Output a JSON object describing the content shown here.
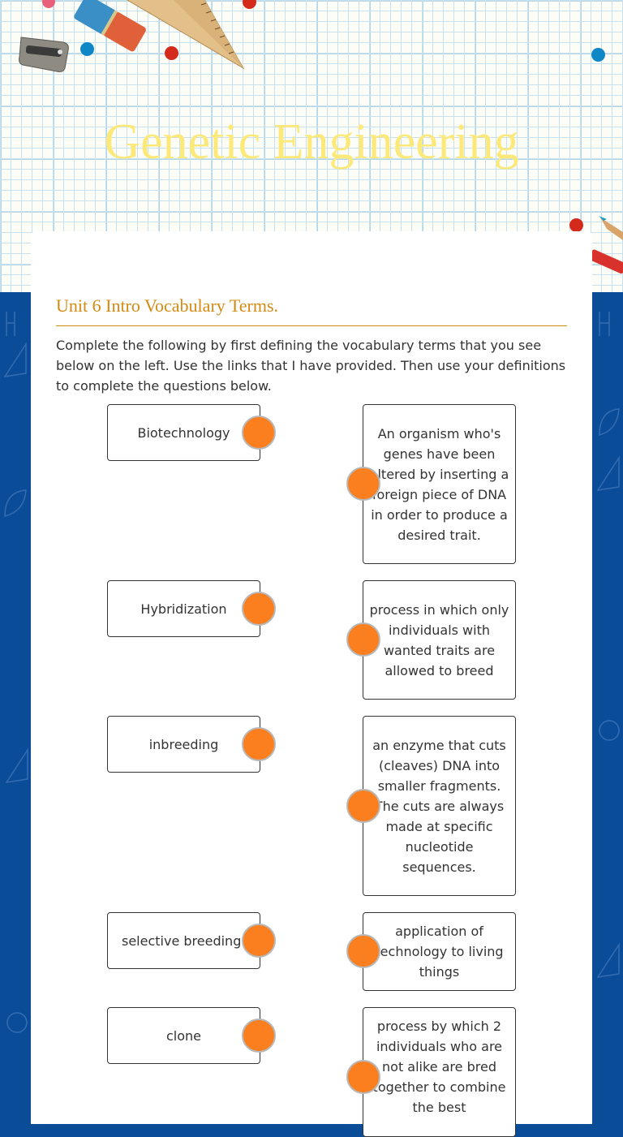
{
  "worksheet": {
    "title": "Genetic Engineering",
    "section_title": "Unit 6 Intro Vocabulary Terms.",
    "instructions": "Complete the following by first defining the vocabulary terms that you see below on the left. Use the links that I have provided. Then use your definitions to complete the questions below."
  },
  "matching": {
    "terms": [
      {
        "label": "Biotechnology"
      },
      {
        "label": "Hybridization"
      },
      {
        "label": "inbreeding"
      },
      {
        "label": "selective breeding"
      },
      {
        "label": "clone"
      }
    ],
    "definitions": [
      {
        "label": "An organism who's genes have been altered by inserting a foreign piece of DNA in order to produce a desired trait."
      },
      {
        "label": "process in which only individuals with wanted traits are allowed to breed"
      },
      {
        "label": "an enzyme that cuts (cleaves) DNA into smaller fragments. The cuts are always made at specific nucleotide sequences."
      },
      {
        "label": "application of technology to living things"
      },
      {
        "label": "process by which 2 individuals who are not alike are bred together to combine the best"
      }
    ]
  },
  "colors": {
    "title": "#fde97a",
    "section_title": "#d38a13",
    "connector": "#fb7f1e",
    "background_blue": "#0b4c99"
  }
}
